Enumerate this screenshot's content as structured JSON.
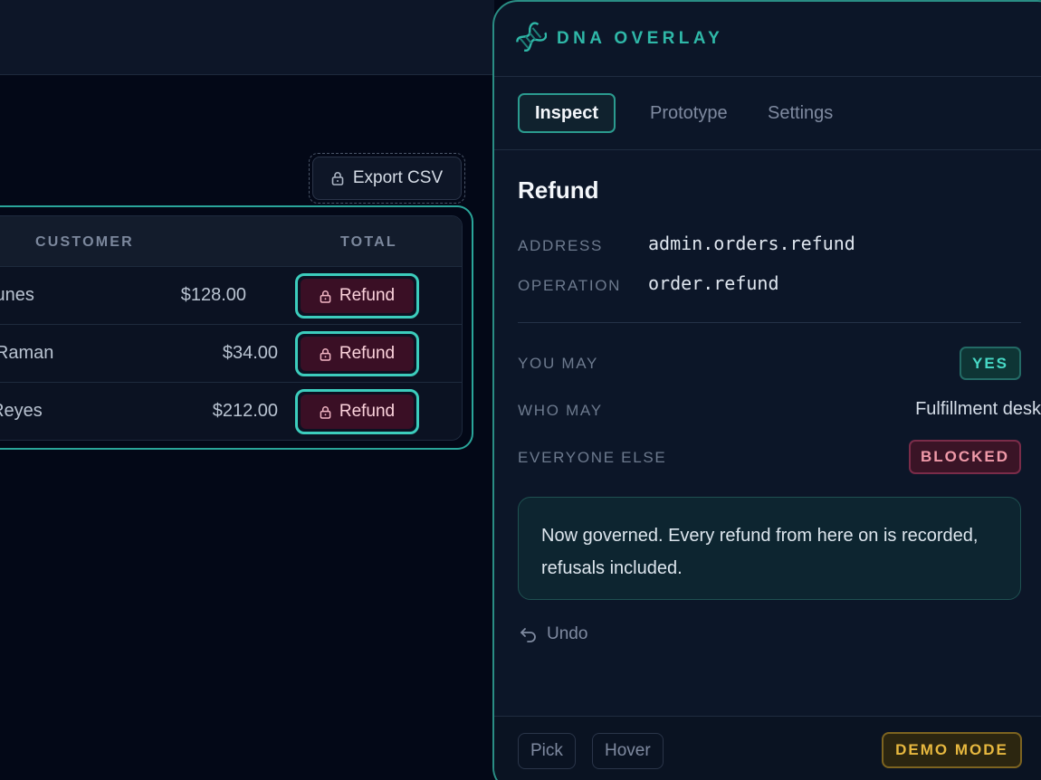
{
  "app": {
    "export_label": "Export CSV",
    "columns": {
      "customer": "CUSTOMER",
      "total": "TOTAL"
    },
    "rows": [
      {
        "customer": ". Nunes",
        "total": "$128.00",
        "action": "Refund"
      },
      {
        "customer": "P. Raman",
        "total": "$34.00",
        "action": "Refund"
      },
      {
        "customer": "T. Reyes",
        "total": "$212.00",
        "action": "Refund"
      }
    ]
  },
  "overlay": {
    "brand": "DNA OVERLAY",
    "tabs": [
      "Inspect",
      "Prototype",
      "Settings"
    ],
    "active_tab": "Inspect",
    "title": "Refund",
    "fields": {
      "address_label": "ADDRESS",
      "address_value": "admin.orders.refund",
      "operation_label": "OPERATION",
      "operation_value": "order.refund"
    },
    "permissions": {
      "you_may_label": "YOU MAY",
      "you_may_value": "YES",
      "who_may_label": "WHO MAY",
      "who_may_value": "Fulfillment desk",
      "everyone_else_label": "EVERYONE ELSE",
      "everyone_else_value": "BLOCKED"
    },
    "note": "Now governed. Every refund from here on is recorded, refusals included.",
    "undo_label": "Undo",
    "footer": {
      "pick": "Pick",
      "hover": "Hover",
      "mode": "DEMO MODE"
    }
  },
  "colors": {
    "accent": "#2fb8a8",
    "highlight_ring": "#3ccdbd",
    "danger": "#f09aa9",
    "warning": "#e7b83f",
    "background": "#030817"
  },
  "icons": {
    "lock": "lock-icon",
    "logo": "dna-logo-icon",
    "undo": "undo-icon"
  }
}
